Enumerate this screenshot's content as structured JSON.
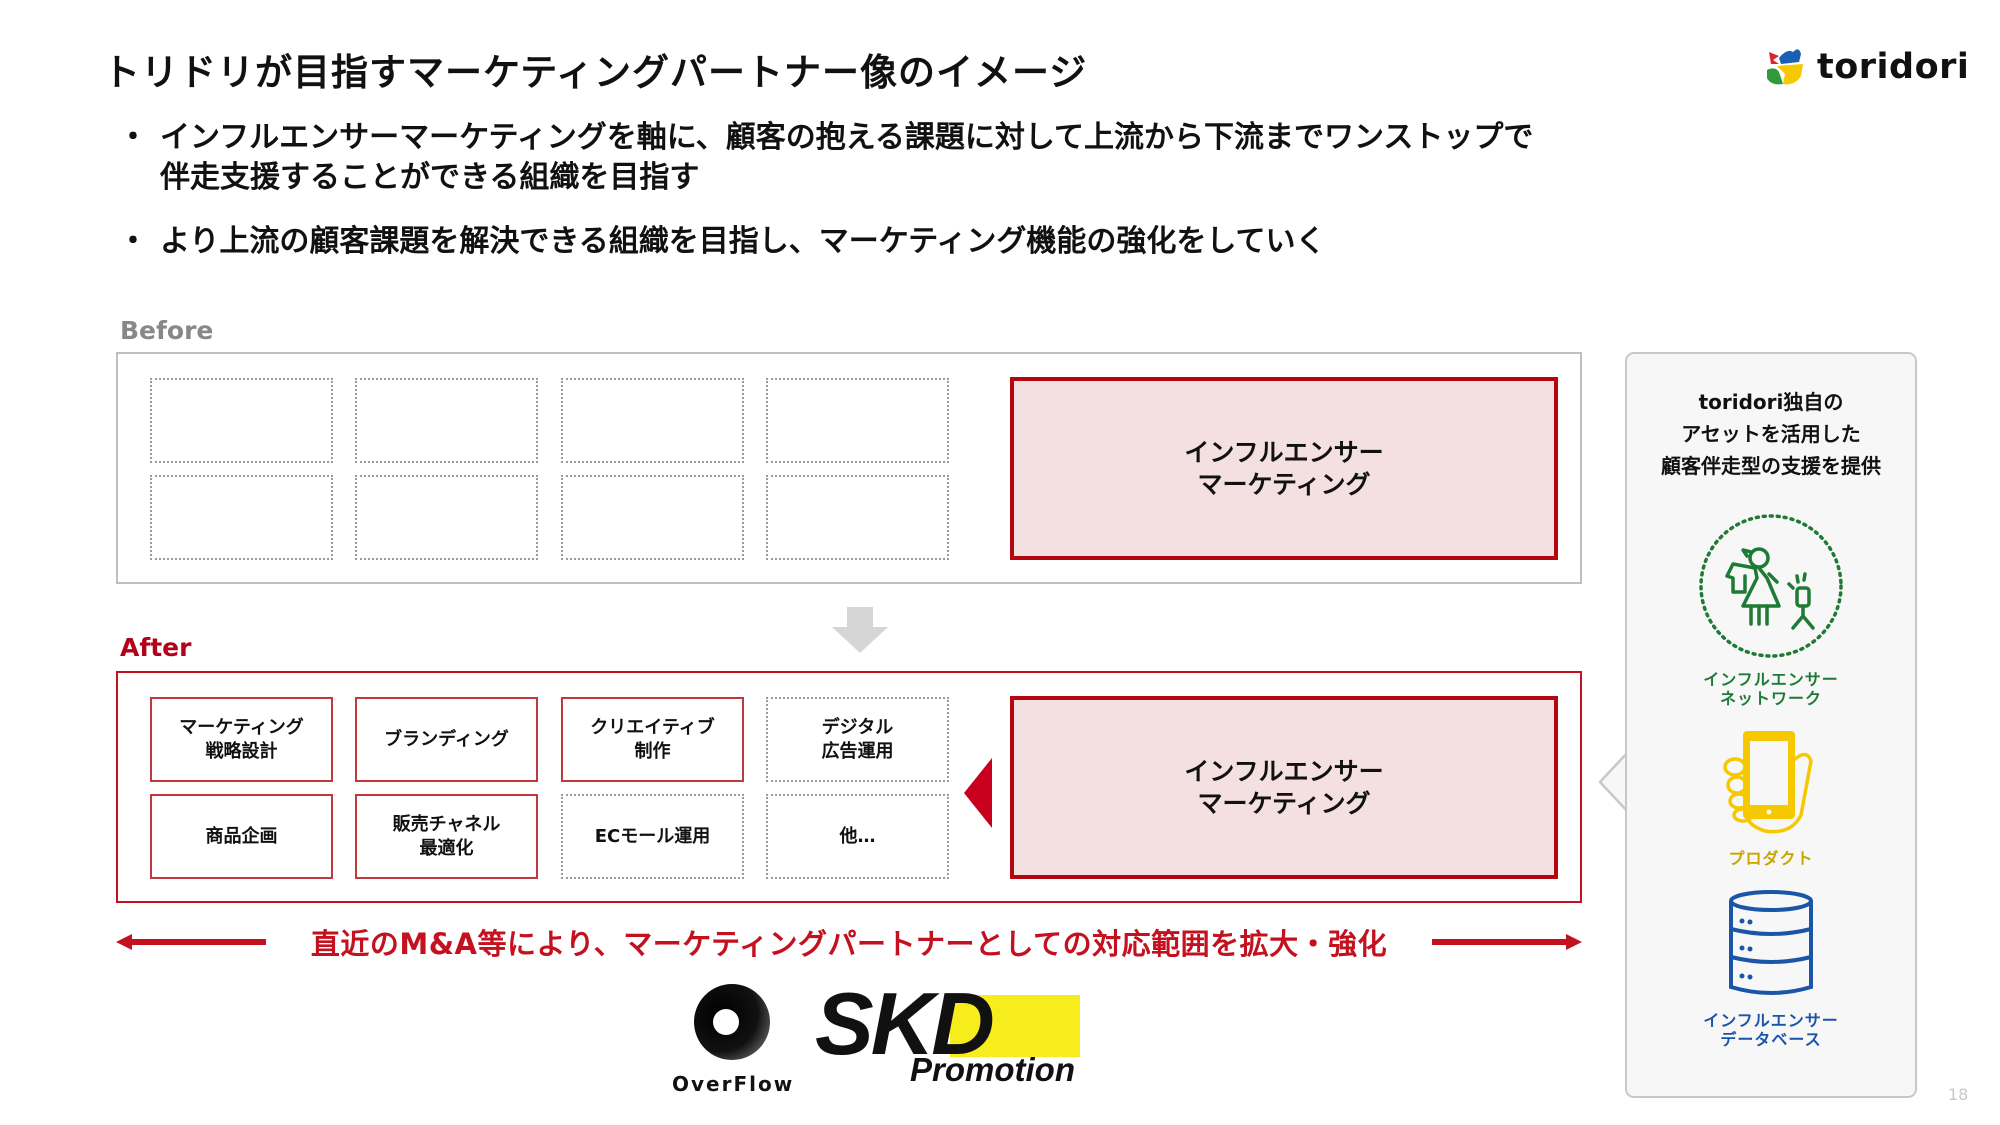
{
  "title": "トリドリが目指すマーケティングパートナー像のイメージ",
  "logo": {
    "text": "toridori",
    "colors": [
      "#d7262d",
      "#1a5fb4",
      "#f5c800",
      "#2e9a3a"
    ]
  },
  "bullets": [
    {
      "lines": [
        "インフルエンサーマーケティングを軸に、顧客の抱える課題に対して上流から下流までワンストップで",
        "伴走支援することができる組織を目指す"
      ]
    },
    {
      "lines": [
        "より上流の顧客課題を解決できる組織を目指し、マーケティング機能の強化をしていく"
      ]
    }
  ],
  "bullet_marker": "・",
  "before": {
    "label": "Before",
    "cells": [
      {
        "text": "",
        "style": "dotted"
      },
      {
        "text": "",
        "style": "dotted"
      },
      {
        "text": "",
        "style": "dotted"
      },
      {
        "text": "",
        "style": "dotted"
      },
      {
        "text": "",
        "style": "dotted"
      },
      {
        "text": "",
        "style": "dotted"
      },
      {
        "text": "",
        "style": "dotted"
      },
      {
        "text": "",
        "style": "dotted"
      }
    ],
    "core": {
      "line1": "インフルエンサー",
      "line2": "マーケティング"
    }
  },
  "after": {
    "label": "After",
    "cells": [
      {
        "line1": "マーケティング",
        "line2": "戦略設計",
        "style": "solid"
      },
      {
        "line1": "ブランディング",
        "line2": "",
        "style": "solid"
      },
      {
        "line1": "クリエイティブ",
        "line2": "制作",
        "style": "solid"
      },
      {
        "line1": "デジタル",
        "line2": "広告運用",
        "style": "dotted"
      },
      {
        "line1": "商品企画",
        "line2": "",
        "style": "solid"
      },
      {
        "line1": "販売チャネル",
        "line2": "最適化",
        "style": "solid"
      },
      {
        "line1": "ECモール運用",
        "line2": "",
        "style": "dotted"
      },
      {
        "line1": "他…",
        "line2": "",
        "style": "dotted"
      }
    ],
    "core": {
      "line1": "インフルエンサー",
      "line2": "マーケティング"
    }
  },
  "expansion_note": "直近のM&A等により、マーケティングパートナーとしての対応範囲を拡大・強化",
  "acquired_logos": [
    {
      "name": "OverFlow"
    },
    {
      "name": "SKD",
      "sub": "Promotion"
    }
  ],
  "right_panel": {
    "heading": [
      "toridori独自の",
      "アセットを活用した",
      "顧客伴走型の支援を提供"
    ],
    "assets": [
      {
        "icon": "influencer-network-icon",
        "line1": "インフルエンサー",
        "line2": "ネットワーク",
        "color": "#1e7a35"
      },
      {
        "icon": "smartphone-hand-icon",
        "line1": "プロダクト",
        "line2": "",
        "color": "#f5c800"
      },
      {
        "icon": "database-icon",
        "line1": "インフルエンサー",
        "line2": "データベース",
        "color": "#1a55a8"
      }
    ]
  },
  "colors": {
    "accent_red": "#c4111f",
    "core_fill": "#f4dfe1",
    "frame_gray": "#bfbfbf"
  },
  "page_number": "18"
}
